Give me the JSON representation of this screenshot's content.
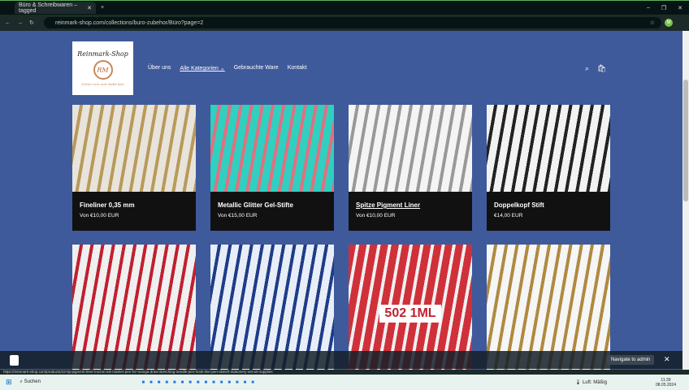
{
  "browser": {
    "tab_title": "Büro & Schreibwaren – tagged",
    "url": "reinmark-shop.com/collections/buro-zubehor/Büro?page=2",
    "profile_initial": "M"
  },
  "shop": {
    "logo_text": "Reinmark-Shop",
    "logo_initials": "RM",
    "logo_tagline": "Schön rein und stabil fein",
    "nav": [
      {
        "label": "Über uns"
      },
      {
        "label": "Alle Kategorien"
      },
      {
        "label": "Gebrauchte Ware"
      },
      {
        "label": "Kontakt"
      }
    ]
  },
  "products": [
    {
      "title": "Fineliner 0,35 mm",
      "price": "Von €10,00 EUR",
      "colors": [
        "#e8e4dc",
        "#b89a5a"
      ]
    },
    {
      "title": "Metallic Glitter Gel-Stifte",
      "price": "Von €15,00 EUR",
      "colors": [
        "#2fd0c0",
        "#e07080"
      ]
    },
    {
      "title": "Spitze Pigment Liner",
      "price": "Von €10,00 EUR",
      "colors": [
        "#f4f4f4",
        "#999"
      ]
    },
    {
      "title": "Doppelkopf Stift",
      "price": "€14,00 EUR",
      "colors": [
        "#f2f2f2",
        "#222"
      ]
    },
    {
      "title": "",
      "price": "",
      "colors": [
        "#f0f0f0",
        "#c02030"
      ]
    },
    {
      "title": "",
      "price": "",
      "colors": [
        "#e8eef8",
        "#1f3c88"
      ]
    },
    {
      "title": "",
      "price": "",
      "colors": [
        "#d0303a",
        "#f0f0f0"
      ],
      "overlay": "502 1ML"
    },
    {
      "title": "",
      "price": "",
      "colors": [
        "#f6f6f6",
        "#b08a40"
      ]
    }
  ],
  "admin_bar": {
    "button": "Navigate to admin"
  },
  "status_url": "https://reinmark-shop.com/products/12-tip-pigment-liner-micron-ink-marker-pen-for-manga-draw-sketching-needle-pen-hook-line-pen-sketch-stationery-set-art-supplies",
  "taskbar": {
    "search": "Suchen",
    "weather": "Luft: Mäßig",
    "time": "11:39",
    "date": "08.05.2024"
  }
}
